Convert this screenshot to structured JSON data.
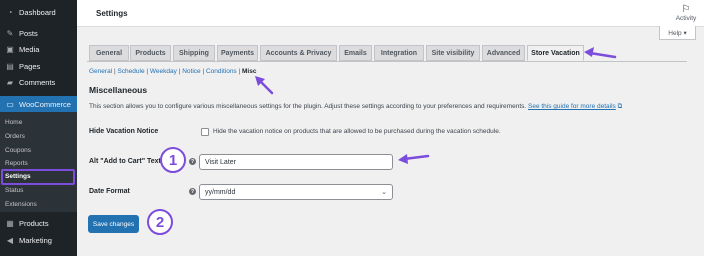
{
  "sidebar": {
    "items": [
      {
        "label": "Dashboard",
        "icon": "dashboard-icon",
        "glyph": "◔"
      },
      {
        "label": "Posts",
        "icon": "pin-icon",
        "glyph": "✎"
      },
      {
        "label": "Media",
        "icon": "media-icon",
        "glyph": "▣"
      },
      {
        "label": "Pages",
        "icon": "pages-icon",
        "glyph": "▤"
      },
      {
        "label": "Comments",
        "icon": "comments-icon",
        "glyph": "▰"
      },
      {
        "label": "WooCommerce",
        "icon": "woo-icon",
        "glyph": "▭"
      }
    ],
    "sub_items": [
      "Home",
      "Orders",
      "Coupons",
      "Reports",
      "Settings",
      "Status",
      "Extensions"
    ],
    "bottom_items": [
      {
        "label": "Products",
        "icon": "products-icon",
        "glyph": "▦"
      },
      {
        "label": "Marketing",
        "icon": "megaphone-icon",
        "glyph": "◀"
      }
    ]
  },
  "header": {
    "title": "Settings",
    "activity_label": "Activity",
    "help_label": "Help ▾"
  },
  "tabs": [
    "General",
    "Products",
    "Shipping",
    "Payments",
    "Accounts & Privacy",
    "Emails",
    "Integration",
    "Site visibility",
    "Advanced",
    "Store Vacation"
  ],
  "subnav": {
    "links": [
      "General",
      "Schedule",
      "Weekday",
      "Notice",
      "Conditions"
    ],
    "current": "Misc"
  },
  "section": {
    "title": "Miscellaneous",
    "description": "This section allows you to configure various miscellaneous settings for the plugin. Adjust these settings according to your preferences and requirements.",
    "guide_link": "See this guide for more details"
  },
  "fields": {
    "hide_notice": {
      "label": "Hide Vacation Notice",
      "checkbox_text": "Hide the vacation notice on products that are allowed to be purchased during the vacation schedule."
    },
    "add_to_cart": {
      "label": "Alt \"Add to Cart\" Text",
      "value": "Visit Later"
    },
    "date_format": {
      "label": "Date Format",
      "value": "yy/mm/dd"
    }
  },
  "save_label": "Save changes",
  "annotations": {
    "one": "1",
    "two": "2"
  },
  "colors": {
    "accent": "#2271b1",
    "annotation": "#7c4ddc",
    "sidebar": "#1d2327"
  }
}
